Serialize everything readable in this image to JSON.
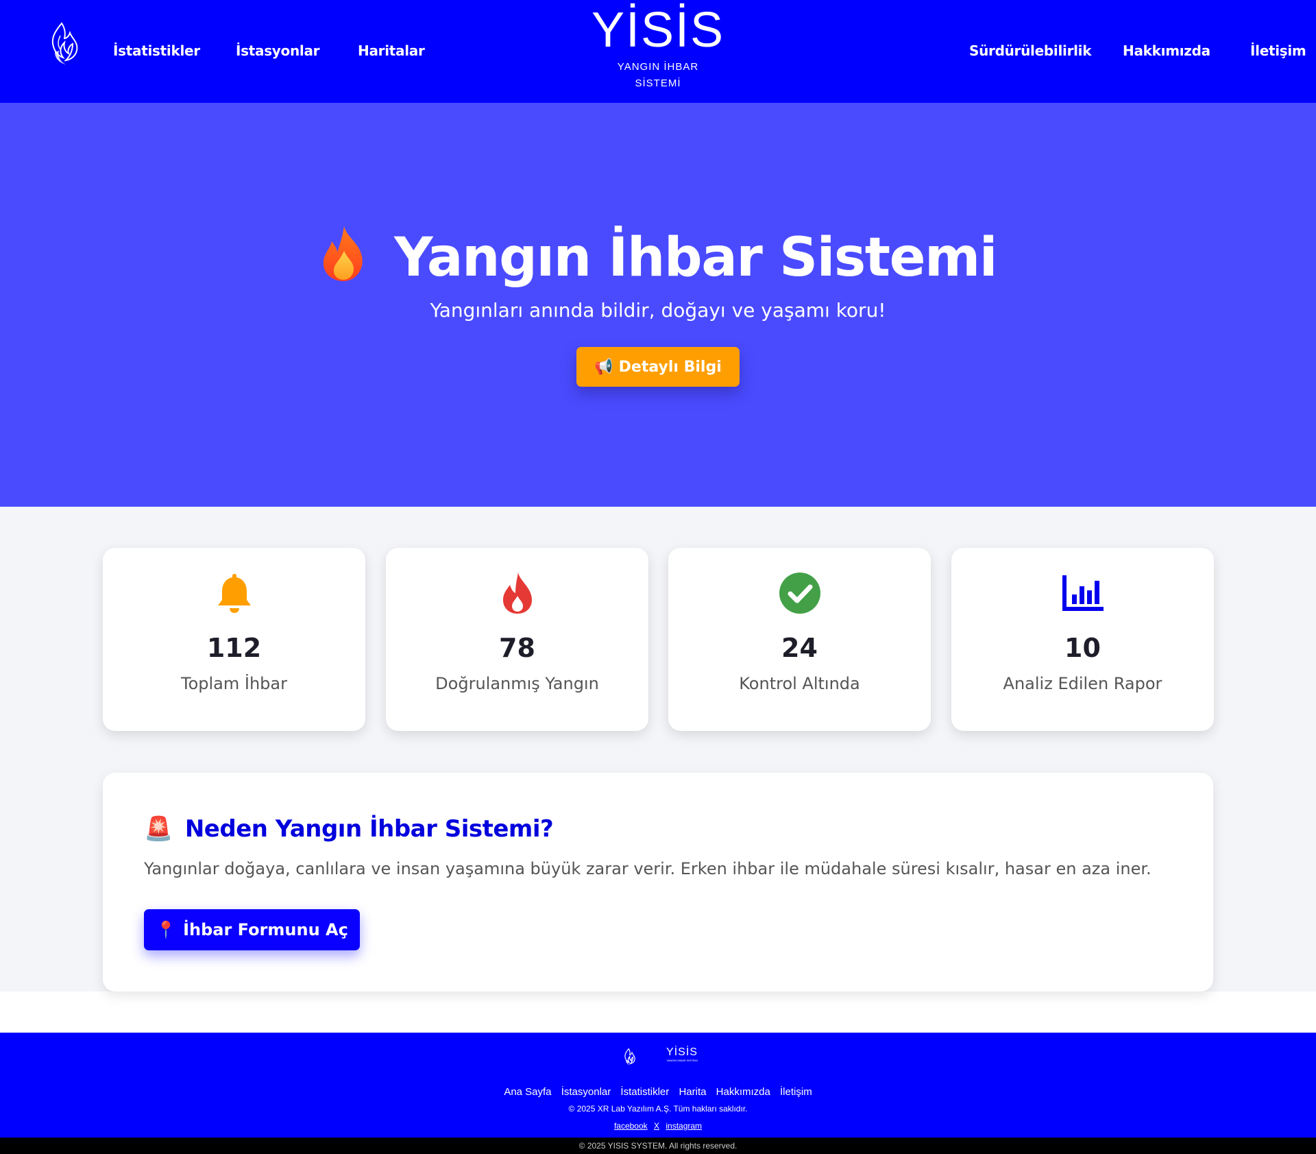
{
  "nav": {
    "links_left": [
      "İstatistikler",
      "İstasyonlar",
      "Haritalar"
    ],
    "links_right": [
      "Sürdürülebilirlik",
      "Hakkımızda",
      "İletişim"
    ],
    "brand_title": "YİSİS",
    "brand_sub_1": "YANGIN İHBAR",
    "brand_sub_2": "SİSTEMİ"
  },
  "hero": {
    "title": "Yangın İhbar Sistemi",
    "subtitle": "Yangınları anında bildir, doğayı ve yaşamı koru!",
    "button_icon": "📢",
    "button_label": "Detaylı Bilgi"
  },
  "stats": [
    {
      "icon": "bell-icon",
      "value": "112",
      "label": "Toplam İhbar",
      "color": "#ff9e00"
    },
    {
      "icon": "fire-icon",
      "value": "78",
      "label": "Doğrulanmış Yangın",
      "color": "#e53935"
    },
    {
      "icon": "check-circle-icon",
      "value": "24",
      "label": "Kontrol Altında",
      "color": "#43a047"
    },
    {
      "icon": "chart-bar-icon",
      "value": "10",
      "label": "Analiz Edilen Rapor",
      "color": "#0000ee"
    }
  ],
  "why": {
    "icon": "🚨",
    "heading": "Neden Yangın İhbar Sistemi?",
    "text": "Yangınlar doğaya, canlılara ve insan yaşamına büyük zarar verir. Erken ihbar ile müdahale süresi kısalır, hasar en aza iner.",
    "button_icon": "📍",
    "button_label": "İhbar Formunu Aç"
  },
  "footer": {
    "brand_title": "YİSİS",
    "brand_sub": "YANGIN İHBAR SİSTEMİ",
    "links": [
      "Ana Sayfa",
      "İstasyonlar",
      "İstatistikler",
      "Harita",
      "Hakkımızda",
      "İletişim"
    ],
    "copyright": "© 2025 XR Lab Yazılım A.Ş. Tüm hakları saklıdır.",
    "social": [
      "facebook",
      "X",
      "instagram"
    ],
    "bottom": "© 2025 YISIS SYSTEM. All rights reserved."
  },
  "colors": {
    "nav_bg": "#0000ff",
    "hero_bg": "#4a4bff",
    "accent_orange": "#ff9e00",
    "primary_blue": "#0a00ff"
  }
}
